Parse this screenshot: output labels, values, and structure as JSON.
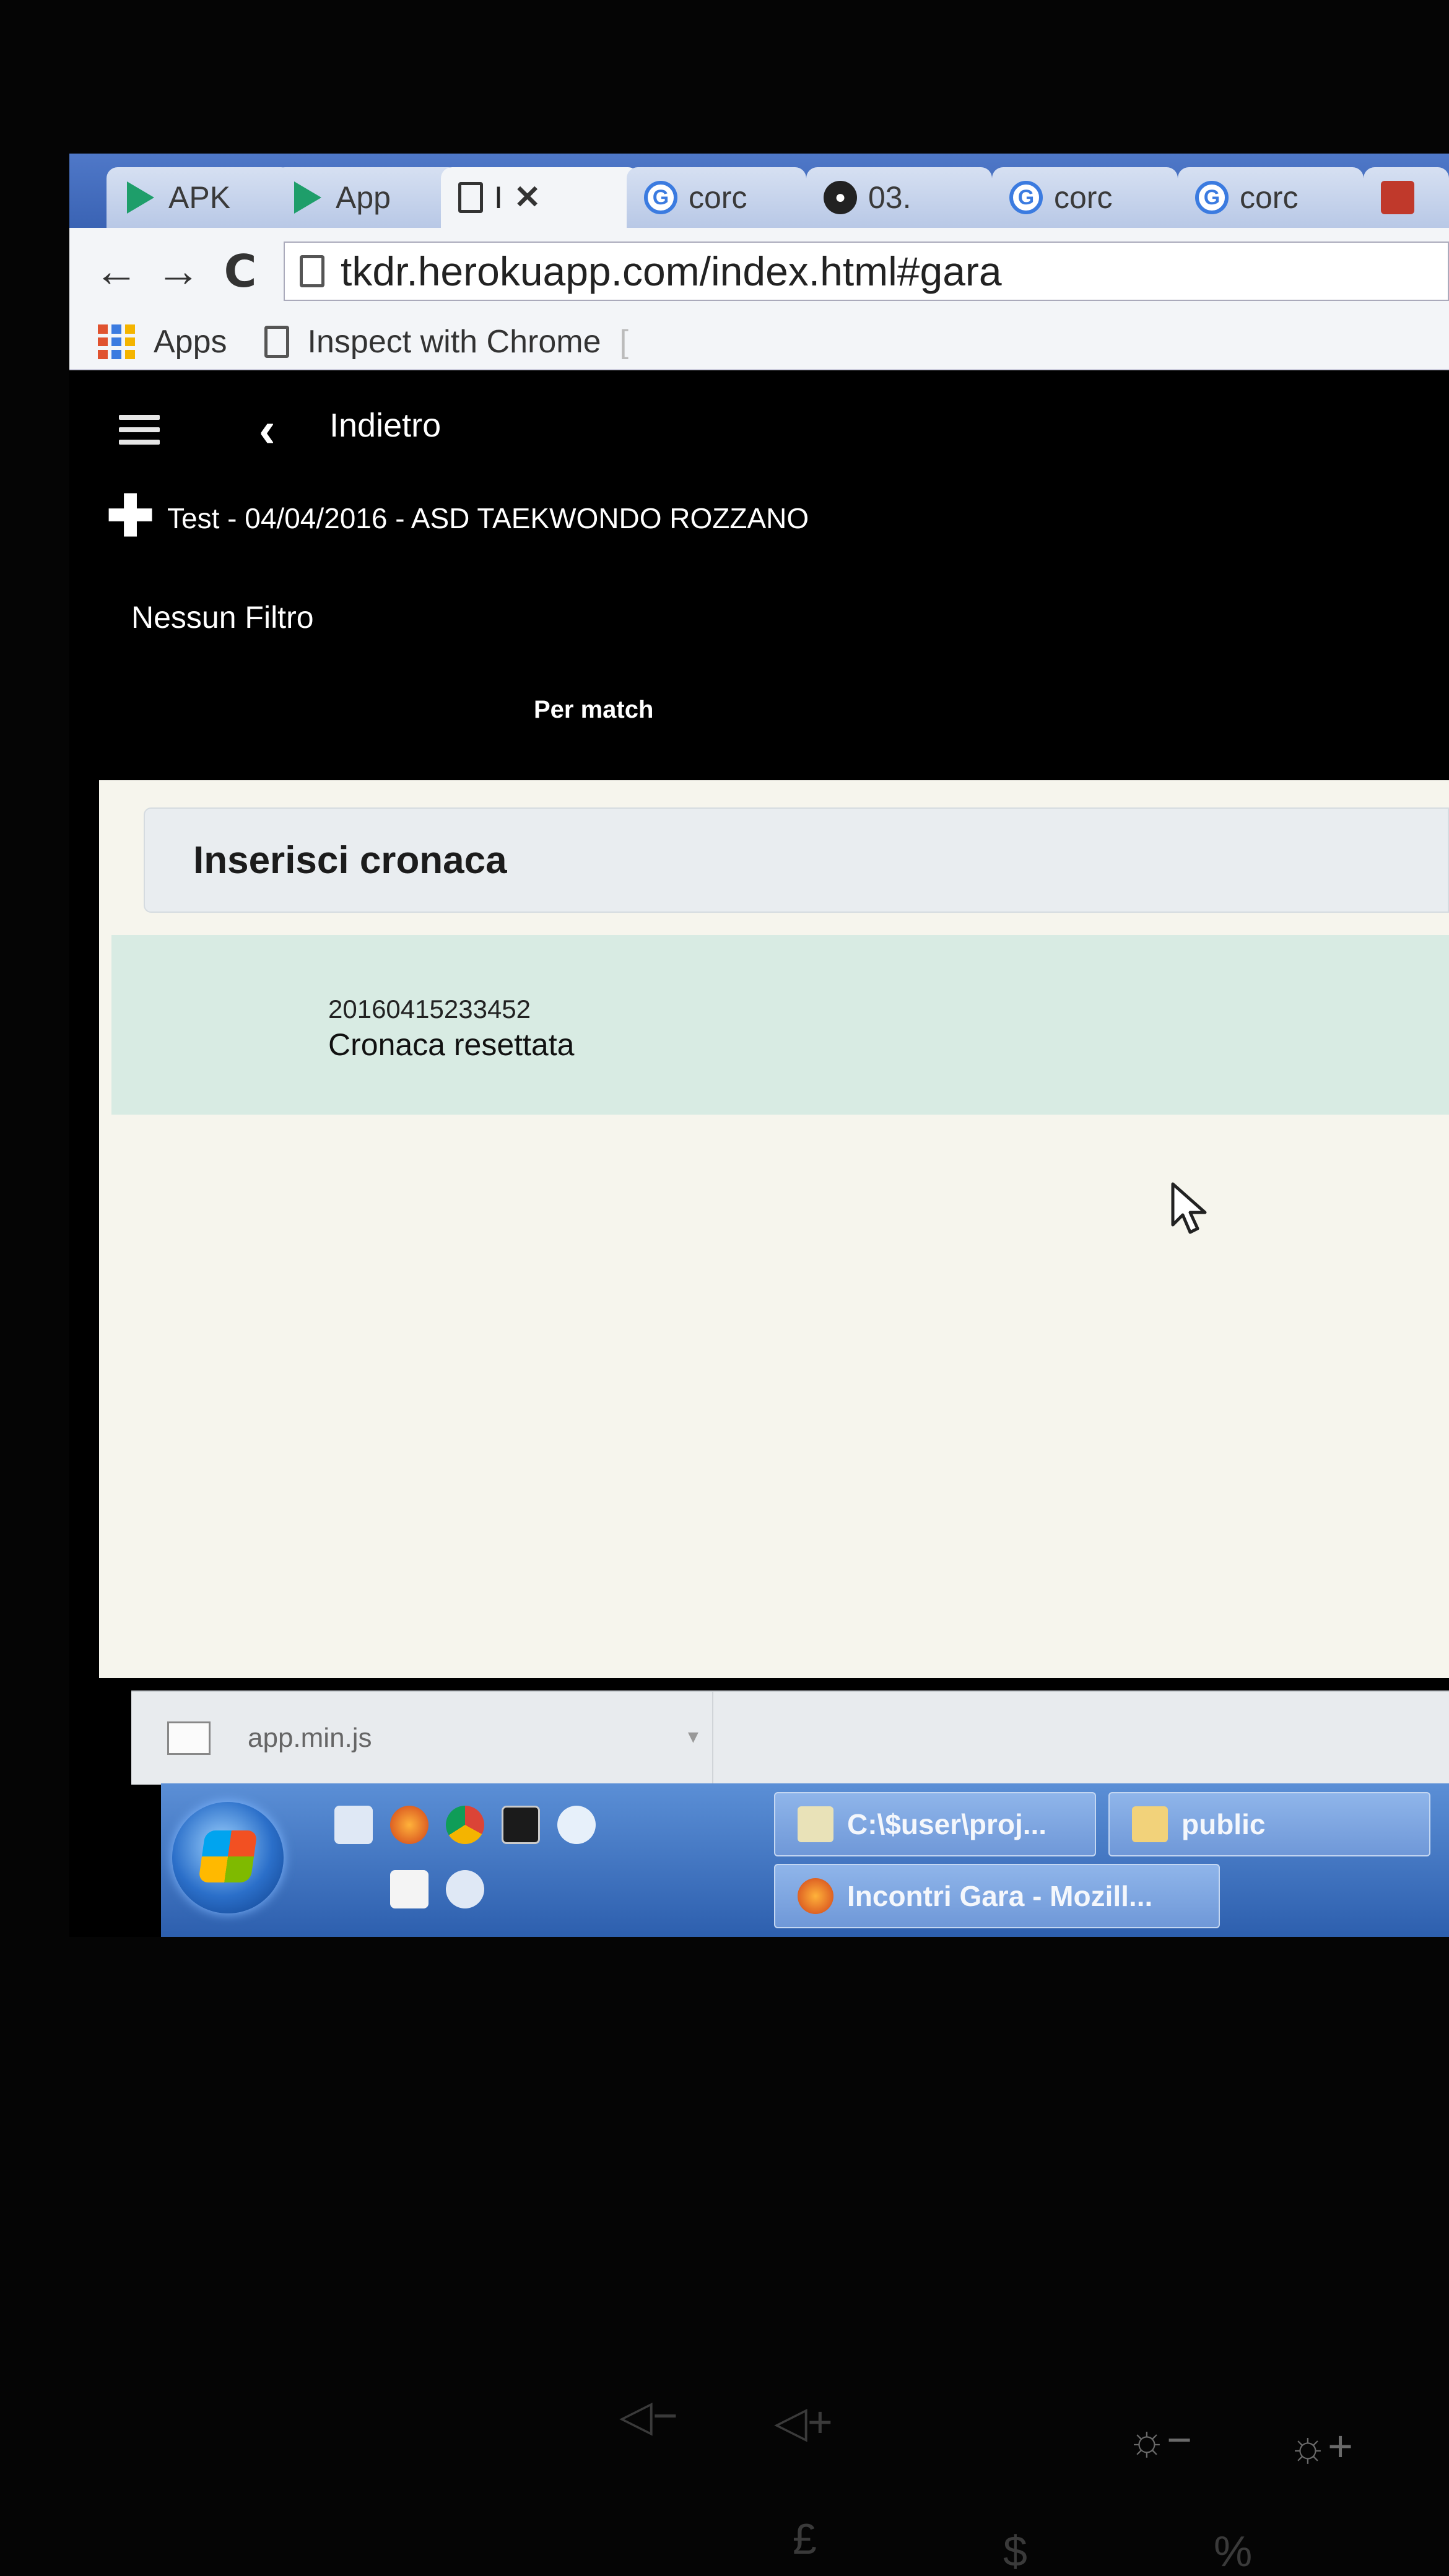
{
  "browser": {
    "tabs": [
      {
        "label": "APK",
        "icon": "play-store-icon"
      },
      {
        "label": "App",
        "icon": "play-store-icon"
      },
      {
        "label": "I",
        "icon": "page-icon",
        "active": true
      },
      {
        "label": "corc",
        "icon": "google-icon"
      },
      {
        "label": "03.",
        "icon": "github-icon"
      },
      {
        "label": "corc",
        "icon": "google-icon"
      },
      {
        "label": "corc",
        "icon": "google-icon"
      }
    ],
    "close_glyph": "✕",
    "nav": {
      "back": "←",
      "forward": "→",
      "reload": "C"
    },
    "url": "tkdr.herokuapp.com/index.html#gara",
    "bookmarks": [
      {
        "label": "Apps",
        "icon": "apps-grid-icon"
      },
      {
        "label": "Inspect with Chrome",
        "icon": "page-icon"
      }
    ],
    "bookmark_overflow": "["
  },
  "app": {
    "back_label": "Indietro",
    "event_title": "Test - 04/04/2016 - ASD TAEKWONDO ROZZANO",
    "filter_label": "Nessun Filtro",
    "view_toggle": "Per match",
    "panel_title": "Inserisci cronaca",
    "log": [
      {
        "timestamp": "20160415233452",
        "message": "Cronaca resettata"
      }
    ]
  },
  "download_bar": {
    "file": "app.min.js"
  },
  "taskbar": {
    "windows": [
      {
        "label": "C:\\$user\\proj...",
        "icon": "notepad-icon"
      },
      {
        "label": "public",
        "icon": "folder-icon"
      },
      {
        "label": "Incontri Gara - Mozill...",
        "icon": "firefox-icon"
      }
    ]
  },
  "keyboard": {
    "keys": [
      "◁−",
      "◁+",
      "☼−",
      "☼+",
      "£",
      "$",
      "%"
    ]
  },
  "colors": {
    "tabstrip": "#3a63b4",
    "app_background": "#000000",
    "panel_header": "#e9edf0",
    "log_entry": "#d8ebe3",
    "content_background": "#f6f5ed",
    "taskbar": "#2d5fae"
  }
}
